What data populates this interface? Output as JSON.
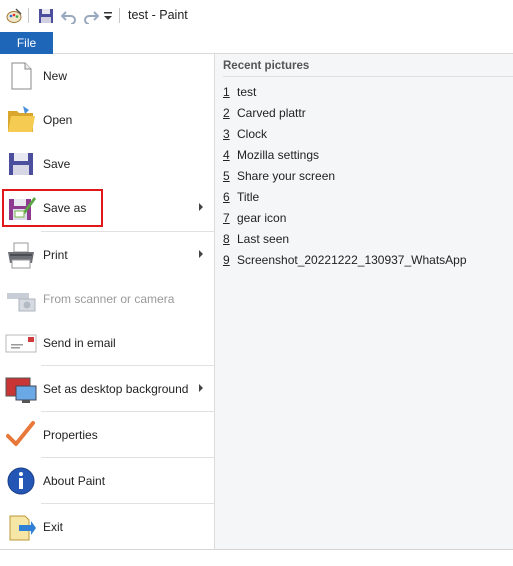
{
  "titlebar": {
    "title": "test - Paint",
    "quick_access": [
      {
        "icon": "paint-palette-icon"
      },
      {
        "icon": "save-icon"
      },
      {
        "icon": "undo-icon"
      },
      {
        "icon": "redo-icon"
      },
      {
        "icon": "customize-dropdown-icon"
      }
    ]
  },
  "file_tab": {
    "label": "File"
  },
  "menu": {
    "items": [
      {
        "name": "new",
        "label": "New",
        "icon": "new-document-icon",
        "enabled": true,
        "submenu": false
      },
      {
        "name": "open",
        "label": "Open",
        "icon": "open-folder-icon",
        "enabled": true,
        "submenu": false
      },
      {
        "name": "save",
        "label": "Save",
        "icon": "save-icon",
        "enabled": true,
        "submenu": false
      },
      {
        "name": "save-as",
        "label": "Save as",
        "icon": "save-as-icon",
        "enabled": true,
        "submenu": true,
        "highlighted": true
      },
      {
        "name": "print",
        "label": "Print",
        "icon": "printer-icon",
        "enabled": true,
        "submenu": true
      },
      {
        "name": "from-scanner",
        "label": "From scanner or camera",
        "icon": "scanner-camera-icon",
        "enabled": false,
        "submenu": false
      },
      {
        "name": "send-email",
        "label": "Send in email",
        "icon": "email-envelope-icon",
        "enabled": true,
        "submenu": false
      },
      {
        "name": "desktop-background",
        "label": "Set as desktop background",
        "icon": "desktop-background-icon",
        "enabled": true,
        "submenu": true
      },
      {
        "name": "properties",
        "label": "Properties",
        "icon": "checkmark-icon",
        "enabled": true,
        "submenu": false
      },
      {
        "name": "about",
        "label": "About Paint",
        "icon": "info-icon",
        "enabled": true,
        "submenu": false
      },
      {
        "name": "exit",
        "label": "Exit",
        "icon": "exit-icon",
        "enabled": true,
        "submenu": false
      }
    ]
  },
  "recent": {
    "header": "Recent pictures",
    "items": [
      {
        "num": "1",
        "label": "test"
      },
      {
        "num": "2",
        "label": "Carved plattr"
      },
      {
        "num": "3",
        "label": "Clock"
      },
      {
        "num": "4",
        "label": "Mozilla settings"
      },
      {
        "num": "5",
        "label": "Share your screen"
      },
      {
        "num": "6",
        "label": "Title"
      },
      {
        "num": "7",
        "label": "gear icon"
      },
      {
        "num": "8",
        "label": "Last seen"
      },
      {
        "num": "9",
        "label": "Screenshot_20221222_130937_WhatsApp"
      }
    ]
  },
  "colors": {
    "file_tab": "#1e66b8",
    "highlight": "#e01818",
    "recent_bg": "#f5f6f7"
  }
}
